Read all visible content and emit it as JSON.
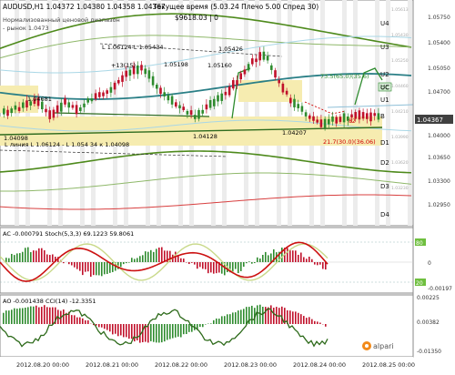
{
  "header": {
    "symbol_line": "AUDUSD,H1  1.04372 1.04380 1.04358 1.04367",
    "time_line": "Текущее время (5.03.24 Плечо 5.00 Спред 30)",
    "pnl_line": "$9618.03   | 0",
    "note_line1": "Нормализованный ценовой диапазон",
    "note_line2": "- рынок 1.0473"
  },
  "main": {
    "price_labels": [
      "1.05750",
      "1.05400",
      "1.05050",
      "1.04700",
      "1.04350",
      "1.04000",
      "1.03650",
      "1.03300",
      "1.02950"
    ],
    "current_price": "1.04367",
    "right_tags": [
      "U4",
      "U3",
      "U2",
      "UC",
      "U1",
      "B",
      "D1",
      "D2",
      "D3",
      "D4"
    ],
    "small_tags": [
      "1.05613",
      "1.05430",
      "1.05250",
      "1.04460",
      "1.04210",
      "1.03990",
      "1.03620",
      "1.03230"
    ],
    "annotations": {
      "fib_top": "L 1.06124-L 1.05434",
      "fib_bottom": "L линия  L 1.06124 - L 1.054 34  к 1.04098",
      "fib_13": "+13(15)",
      "lvl_1": "1.04681",
      "lvl_2": "1.04098",
      "lvl_3": "1.05198",
      "lvl_4": "1.05160",
      "lvl_5": "1.05426",
      "lvl_6": "1.04128",
      "lvl_7": "1.04207",
      "target_up": "73.5(65.0)(35.6)",
      "target_dn": "21.7(30.0)(36.06)",
      "oc": "OC",
      "b_tag": "82"
    }
  },
  "ac_pane": {
    "title": "AC -0.000791  Stoch(5,3,3) 69.1223 59.8061",
    "scale": [
      "80",
      "20",
      "0",
      "-0.00197"
    ],
    "bottom_scale": [
      "0.00225"
    ]
  },
  "ao_pane": {
    "title": "AO -0.001438  CCI(14) -12.3351",
    "scale": [
      "0.00382",
      "-0.01350"
    ]
  },
  "time_axis": {
    "labels": [
      "2012.08.20 00:00",
      "2012.08.21 00:00",
      "2012.08.22 00:00",
      "2012.08.23 00:00",
      "2012.08.24 00:00",
      "2012.08.25 00:00"
    ]
  },
  "branding": {
    "logo_text": "alpari"
  },
  "colors": {
    "up_candle": "#2e8b2e",
    "down_candle": "#c0102a",
    "zone": "#f6ecb0",
    "grid": "#d8d8d8",
    "stoch": "#cc1111",
    "ma_green": "#4e8a1c",
    "teal": "#2a7f86"
  }
}
